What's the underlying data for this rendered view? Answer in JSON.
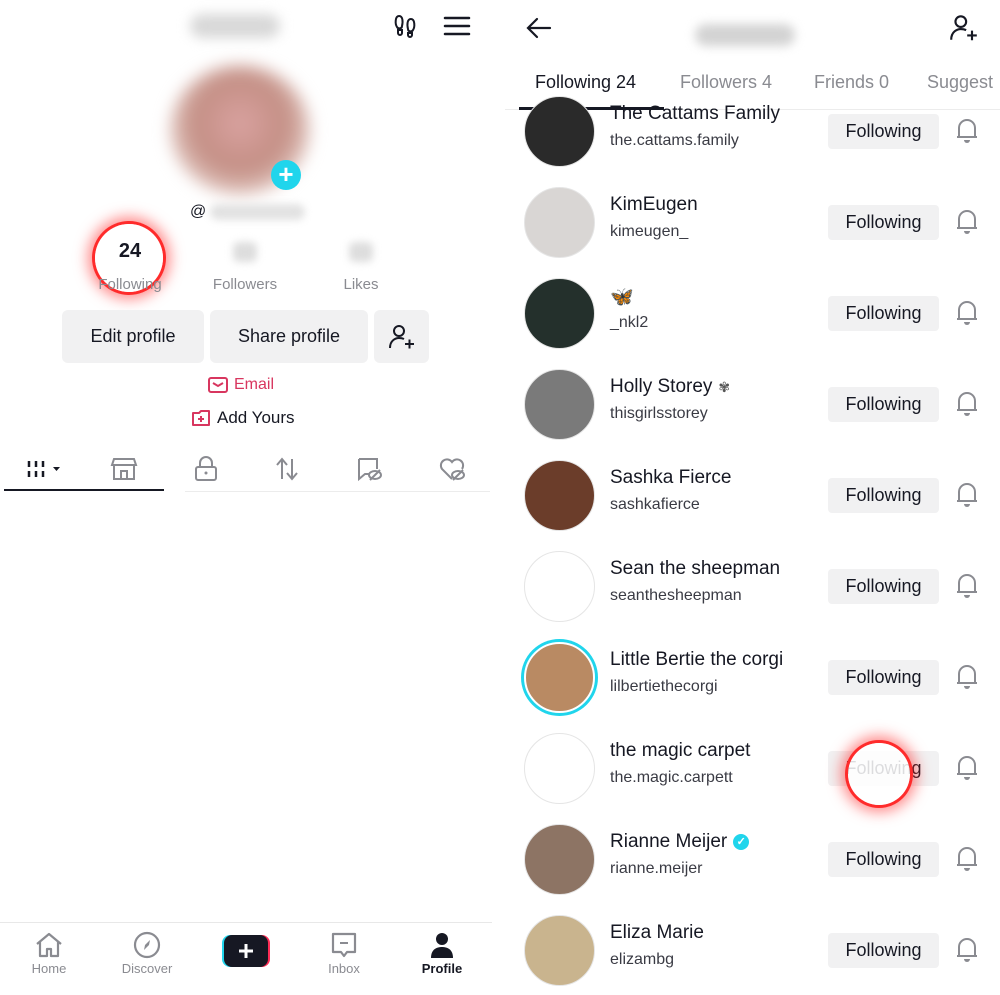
{
  "profile_panel": {
    "handle_prefix": "@",
    "stats": [
      {
        "value": "24",
        "label": "Following"
      },
      {
        "value": "",
        "label": "Followers"
      },
      {
        "value": "",
        "label": "Likes"
      }
    ],
    "buttons": {
      "edit_profile": "Edit profile",
      "share_profile": "Share profile"
    },
    "links": {
      "email": "Email",
      "add_yours": "Add Yours"
    },
    "content_tabs": [
      "videos-grid",
      "shop",
      "private",
      "reposts",
      "favorites-hidden",
      "liked-hidden"
    ],
    "bottom_nav": [
      {
        "label": "Home",
        "icon": "home-icon"
      },
      {
        "label": "Discover",
        "icon": "compass-icon"
      },
      {
        "label": "",
        "icon": "create-plus-icon"
      },
      {
        "label": "Inbox",
        "icon": "inbox-icon"
      },
      {
        "label": "Profile",
        "icon": "profile-icon",
        "active": true
      }
    ],
    "colors": {
      "accent_cyan": "#20d5ec",
      "accent_pink": "#fe2c55",
      "email_color": "#d8365f",
      "highlight_ring": "#ff2b2b"
    }
  },
  "following_panel": {
    "tabs": [
      {
        "label": "Following 24",
        "active": true
      },
      {
        "label": "Followers 4"
      },
      {
        "label": "Friends 0"
      },
      {
        "label": "Suggest"
      }
    ],
    "follow_button_label": "Following",
    "users": [
      {
        "name": "The Cattams Family",
        "handle": "the.cattams.family",
        "avatar_color": "#2a2a2a"
      },
      {
        "name": "KimEugen",
        "handle": "kimeugen_",
        "avatar_color": "#d9d6d4"
      },
      {
        "name": "🦋",
        "handle": "_nkl2",
        "avatar_color": "#24302c"
      },
      {
        "name": "Holly Storey",
        "name_suffix": "✾",
        "handle": "thisgirlsstorey",
        "avatar_color": "#7a7a7a"
      },
      {
        "name": "Sashka Fierce",
        "handle": "sashkafierce",
        "avatar_color": "#6b3d2a"
      },
      {
        "name": "Sean the sheepman",
        "handle": "seanthesheepman",
        "avatar_color": "#ffffff"
      },
      {
        "name": "Little Bertie the corgi",
        "handle": "lilbertiethecorgi",
        "avatar_color": "#b98a63",
        "story_ring": true
      },
      {
        "name": "the magic carpet",
        "handle": "the.magic.carpett",
        "avatar_color": "#ffffff"
      },
      {
        "name": "Rianne Meijer",
        "verified": true,
        "handle": "rianne.meijer",
        "avatar_color": "#8d7464"
      },
      {
        "name": "Eliza Marie",
        "handle": "elizambg",
        "avatar_color": "#c9b48e"
      }
    ]
  }
}
